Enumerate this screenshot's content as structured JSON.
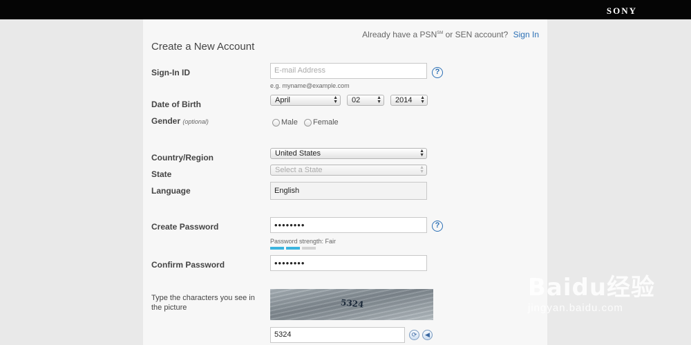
{
  "header": {
    "brand": "SONY"
  },
  "signin_prompt": {
    "text_before": "Already have a PSN",
    "sm_mark": "SM",
    "text_after": " or SEN account?",
    "link": "Sign In"
  },
  "title": "Create a New Account",
  "fields": {
    "signin_id": {
      "label": "Sign-In ID",
      "placeholder": "E-mail Address",
      "hint": "e.g. myname@example.com"
    },
    "dob": {
      "label": "Date of Birth",
      "month": "April",
      "day": "02",
      "year": "2014"
    },
    "gender": {
      "label": "Gender",
      "optional": "(optional)",
      "options": [
        "Male",
        "Female"
      ]
    },
    "country": {
      "label": "Country/Region",
      "value": "United States"
    },
    "state": {
      "label": "State",
      "placeholder": "Select a State"
    },
    "language": {
      "label": "Language",
      "value": "English"
    },
    "password": {
      "label": "Create Password",
      "value": "••••••••",
      "strength": "Password strength: Fair",
      "strength_level": 2,
      "strength_max": 3
    },
    "confirm": {
      "label": "Confirm Password",
      "value": "••••••••"
    },
    "captcha": {
      "label": "Type the characters you see in the picture",
      "image_text": "5324",
      "value": "5324"
    }
  },
  "icons": {
    "help": "help-icon",
    "refresh": "refresh-icon",
    "audio": "audio-icon"
  },
  "colors": {
    "link": "#2a6fb5",
    "strength_on": "#3cb4de",
    "strength_off": "#d2d2d2"
  },
  "watermark": {
    "line1": "Bai",
    "paw": "du",
    "cn": "经验",
    "line2": "jingyan.baidu.com"
  }
}
